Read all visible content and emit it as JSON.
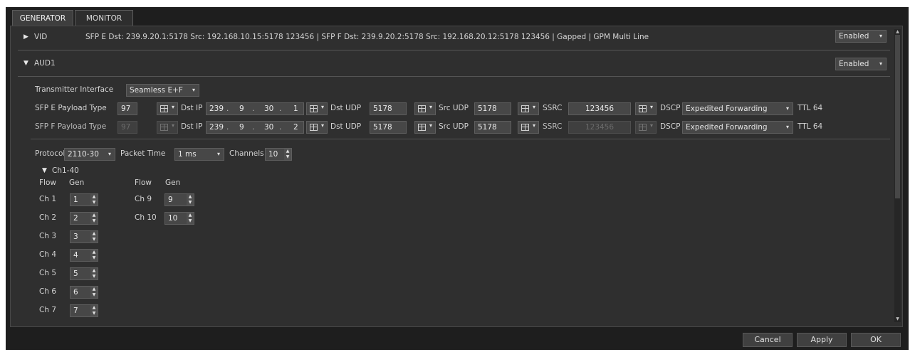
{
  "tabs": [
    "GENERATOR",
    "MONITOR"
  ],
  "vid": {
    "label": "VID",
    "summary": "SFP E Dst: 239.9.20.1:5178 Src: 192.168.10.15:5178 123456 | SFP F Dst: 239.9.20.2:5178 Src: 192.168.20.12:5178 123456 | Gapped | GPM Multi Line",
    "state": "Enabled"
  },
  "aud1": {
    "label": "AUD1",
    "state": "Enabled",
    "transmitter_interface_label": "Transmitter Interface",
    "transmitter_interface_value": "Seamless E+F",
    "sfp_e": {
      "label": "SFP E Payload Type",
      "payload": "97",
      "dst_ip_label": "Dst IP",
      "ip": [
        "239",
        "9",
        "30",
        "1"
      ],
      "dst_udp_label": "Dst UDP",
      "dst_udp": "5178",
      "src_udp_label": "Src UDP",
      "src_udp": "5178",
      "ssrc_label": "SSRC",
      "ssrc": "123456",
      "dscp_label": "DSCP",
      "dscp": "Expedited Forwarding",
      "ttl": "TTL 64"
    },
    "sfp_f": {
      "label": "SFP F Payload Type",
      "payload": "97",
      "dst_ip_label": "Dst IP",
      "ip": [
        "239",
        "9",
        "30",
        "2"
      ],
      "dst_udp_label": "Dst UDP",
      "dst_udp": "5178",
      "src_udp_label": "Src UDP",
      "src_udp": "5178",
      "ssrc_label": "SSRC",
      "ssrc": "123456",
      "dscp_label": "DSCP",
      "dscp": "Expedited Forwarding",
      "ttl": "TTL 64"
    },
    "protocol_label": "Protocol",
    "protocol": "2110-30",
    "packet_time_label": "Packet Time",
    "packet_time": "1 ms",
    "channels_label": "Channels",
    "channels": "10",
    "group_label": "Ch1-40",
    "flow_header": "Flow",
    "gen_header": "Gen",
    "channel_rows": [
      {
        "flow": "Ch 1",
        "gen": "1"
      },
      {
        "flow": "Ch 2",
        "gen": "2"
      },
      {
        "flow": "Ch 3",
        "gen": "3"
      },
      {
        "flow": "Ch 4",
        "gen": "4"
      },
      {
        "flow": "Ch 5",
        "gen": "5"
      },
      {
        "flow": "Ch 6",
        "gen": "6"
      },
      {
        "flow": "Ch 7",
        "gen": "7"
      },
      {
        "flow": "Ch 9",
        "gen": "9"
      },
      {
        "flow": "Ch 10",
        "gen": "10"
      }
    ]
  },
  "footer": {
    "cancel": "Cancel",
    "apply": "Apply",
    "ok": "OK"
  },
  "icons": {
    "expand": "▶",
    "collapse": "▼",
    "dropdown": "▾",
    "spin_up": "▲",
    "spin_down": "▼"
  }
}
